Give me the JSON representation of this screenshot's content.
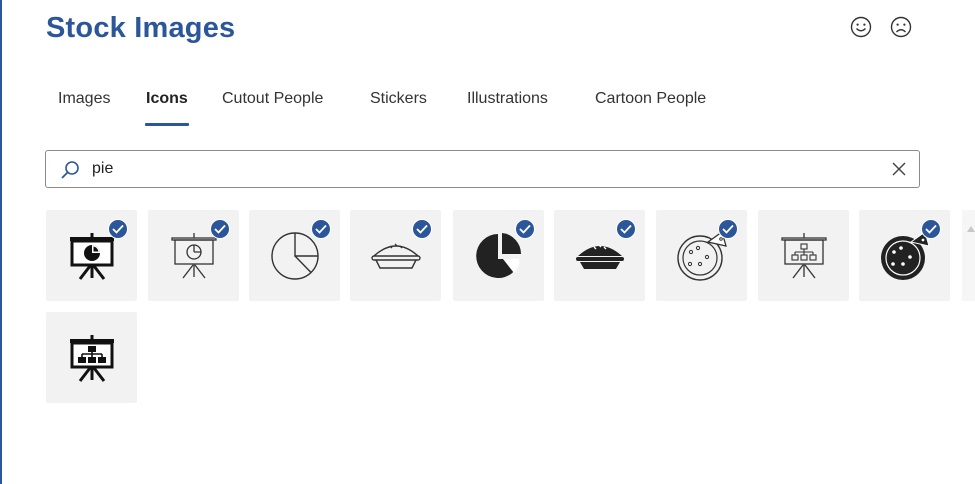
{
  "panel": {
    "title": "Stock Images"
  },
  "feedback": {
    "smile_icon": "smile-icon",
    "frown_icon": "frown-icon"
  },
  "tabs": [
    {
      "label": "Images",
      "active": false
    },
    {
      "label": "Icons",
      "active": true
    },
    {
      "label": "Cutout People",
      "active": false
    },
    {
      "label": "Stickers",
      "active": false
    },
    {
      "label": "Illustrations",
      "active": false
    },
    {
      "label": "Cartoon People",
      "active": false
    }
  ],
  "search": {
    "value": "pie",
    "icon": "search-icon",
    "clear_icon": "close-icon"
  },
  "results": [
    {
      "icon": "presentation-pie-chart-filled-icon",
      "selected": true
    },
    {
      "icon": "presentation-pie-chart-outline-icon",
      "selected": true
    },
    {
      "icon": "pie-chart-outline-icon",
      "selected": true
    },
    {
      "icon": "pie-dessert-outline-icon",
      "selected": true
    },
    {
      "icon": "pie-chart-filled-icon",
      "selected": true
    },
    {
      "icon": "pie-dessert-filled-icon",
      "selected": true
    },
    {
      "icon": "pizza-outline-icon",
      "selected": true
    },
    {
      "icon": "presentation-org-chart-outline-icon",
      "selected": false
    },
    {
      "icon": "pizza-filled-icon",
      "selected": true
    },
    {
      "icon": "presentation-org-chart-filled-icon",
      "selected": false
    }
  ],
  "colors": {
    "accent": "#2b579a",
    "tile_bg": "#f2f2f2",
    "icon": "#222222"
  }
}
